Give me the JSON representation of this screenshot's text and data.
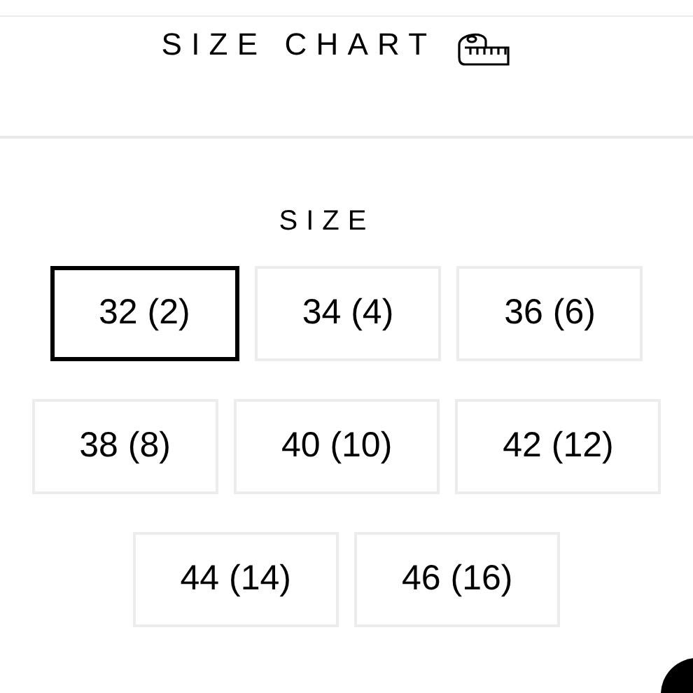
{
  "header": {
    "title": "SIZE CHART"
  },
  "size_picker": {
    "label": "SIZE",
    "options": [
      {
        "label": "32 (2)",
        "selected": true
      },
      {
        "label": "34 (4)",
        "selected": false
      },
      {
        "label": "36 (6)",
        "selected": false
      },
      {
        "label": "38 (8)",
        "selected": false
      },
      {
        "label": "40 (10)",
        "selected": false
      },
      {
        "label": "42 (12)",
        "selected": false
      },
      {
        "label": "44 (14)",
        "selected": false
      },
      {
        "label": "46 (16)",
        "selected": false
      }
    ]
  }
}
